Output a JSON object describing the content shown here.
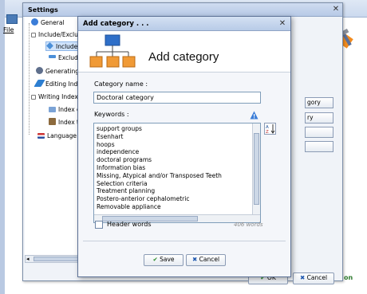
{
  "app": {
    "menu_file": "File",
    "corner_label": "on"
  },
  "settings": {
    "title": "Settings",
    "tree": {
      "items": [
        {
          "label": "General"
        },
        {
          "label": "Include/Exclude"
        },
        {
          "label": "Include"
        },
        {
          "label": "Exclude"
        },
        {
          "label": "Generating"
        },
        {
          "label": "Editing Index"
        },
        {
          "label": "Writing Index"
        },
        {
          "label": "Index c"
        },
        {
          "label": "Index t"
        },
        {
          "label": "Language"
        }
      ]
    },
    "side_buttons": [
      "gory",
      "ry",
      "",
      ""
    ],
    "ok_label": "OK",
    "cancel_label": "Cancel"
  },
  "dialog": {
    "title": "Add category . . .",
    "heading": "Add category",
    "category_name_label": "Category name :",
    "category_name_value": "Doctoral category",
    "keywords_label": "Keywords :",
    "keywords": [
      "support groups",
      "Esenhart",
      "hoops",
      "independence",
      "doctoral programs",
      "Information bias",
      "Missing, Atypical and/or Transposed Teeth",
      "Selection criteria",
      "Treatment planning",
      "Postero-anterior cephalometric",
      "Removable appliance"
    ],
    "header_words_label": "Header words",
    "word_count": "406 words",
    "save_label": "Save",
    "cancel_label": "Cancel"
  }
}
